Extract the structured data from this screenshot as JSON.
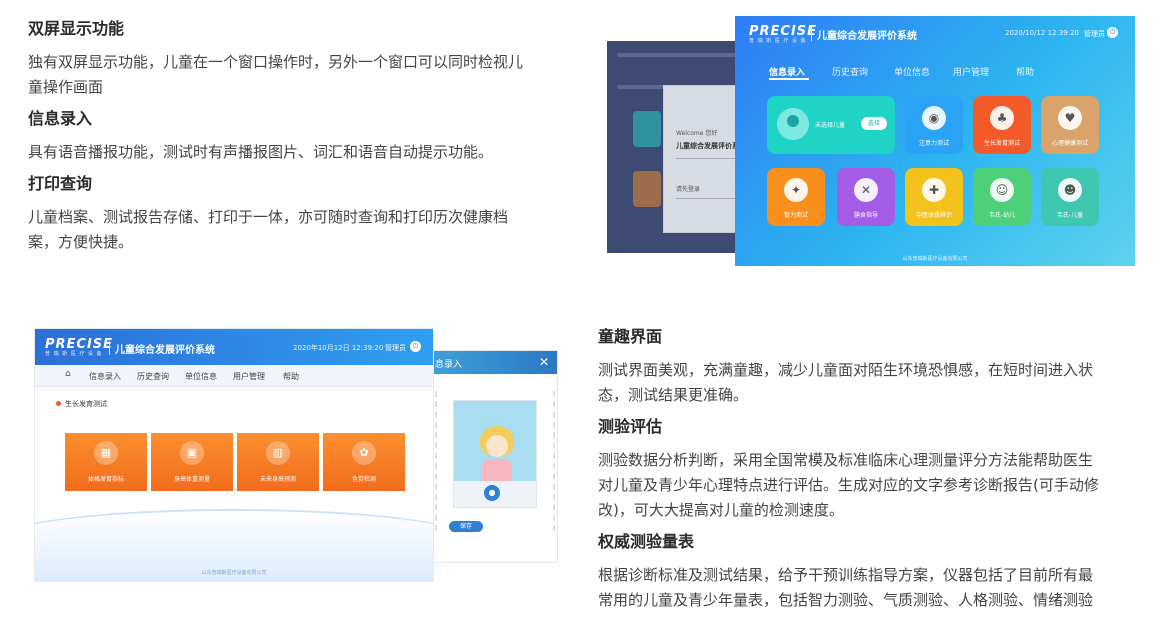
{
  "left_features": [
    {
      "title": "双屏显示功能",
      "lines": [
        "独有双屏显示功能，儿童在一个窗口操作时，另外一个窗口可以同时检视儿",
        "童操作画面"
      ]
    },
    {
      "title": "信息录入",
      "lines": [
        "具有语音播报功能，测试时有声播报图片、词汇和语音自动提示功能。"
      ]
    },
    {
      "title": "打印查询",
      "lines": [
        "儿童档案、测试报告存储、打印于一体，亦可随时查询和打印历次健康档",
        "案，方便快捷。"
      ]
    }
  ],
  "right_features": [
    {
      "title": "童趣界面",
      "lines": [
        "测试界面美观，充满童趣，减少儿童面对陌生环境恐惧感，在短时间进入状",
        "态，测试结果更准确。"
      ]
    },
    {
      "title": "测验评估",
      "lines": [
        "测验数据分析判断，采用全国常模及标准临床心理测量评分方法能帮助医生",
        "对儿童及青少年心理特点进行评估。生成对应的文字参考诊断报告(可手动修",
        "改)，可大大提高对儿童的检测速度。"
      ]
    },
    {
      "title": "权威测验量表",
      "lines": [
        "根据诊断标准及测试结果，给予干预训练指导方案，仪器包括了目前所有最",
        "常用的儿童及青少年量表，包括智力测验、气质测验、人格测验、情绪测验"
      ]
    }
  ],
  "screen1": {
    "logo": "PRECISE",
    "logo_sub": "普 瑞 斯 医 疗 设 备",
    "title": "儿童综合发展评价系统",
    "datetime": "2020/10/12  12:39:20",
    "user": "管理员",
    "nav": [
      "信息录入",
      "历史查询",
      "单位信息",
      "用户管理",
      "帮助"
    ],
    "select_child_label": "未选择儿童",
    "select_button": "选择",
    "tiles": [
      {
        "label": "注意力测试",
        "color": "#2aa2f6",
        "icon": "eye-icon"
      },
      {
        "label": "生长发育测试",
        "color": "#f25a2a",
        "icon": "sprout-icon"
      },
      {
        "label": "心理健康测试",
        "color": "#d9a36a",
        "icon": "heart-hands-icon"
      },
      {
        "label": "智力测试",
        "color": "#f98f1d",
        "icon": "bulb-head-icon"
      },
      {
        "label": "膳食指导",
        "color": "#a45be8",
        "icon": "utensils-icon"
      },
      {
        "label": "中医体质辨识",
        "color": "#f3c21c",
        "icon": "person-plus-icon"
      },
      {
        "label": "韦氏-幼儿",
        "color": "#4dd07a",
        "icon": "child-face-icon"
      },
      {
        "label": "韦氏-儿童",
        "color": "#3fc7b2",
        "icon": "kid-face-icon"
      }
    ],
    "footer": "山东普瑞斯医疗设备有限公司",
    "dialog_welcome": "Welcome 您好",
    "dialog_title": "儿童综合发展评价系",
    "dialog_login": "请先登录"
  },
  "screen2": {
    "logo": "PRECISE",
    "logo_sub": "普 瑞 斯 医 疗 设 备",
    "title": "儿童综合发展评价系统",
    "datetime": "2020年10月12日 12:39:20",
    "user": "管理员",
    "nav": [
      "信息录入",
      "历史查询",
      "单位信息",
      "用户管理",
      "帮助"
    ],
    "section_title": "生长发育测试",
    "cards": [
      {
        "label": "体格发育指标",
        "icon": "chart-icon"
      },
      {
        "label": "身高体重测量",
        "icon": "scale-icon"
      },
      {
        "label": "未来身高预测",
        "icon": "ruler-icon"
      },
      {
        "label": "色觉检测",
        "icon": "palette-icon"
      }
    ],
    "footer": "山东普瑞斯医疗设备有限公司",
    "side_dialog_title": "息录入",
    "side_save": "保存"
  }
}
